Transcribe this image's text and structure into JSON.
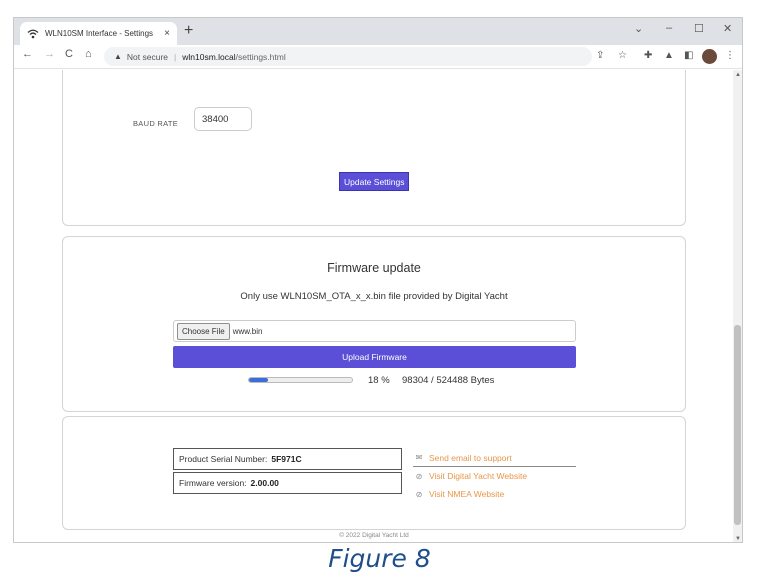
{
  "browser": {
    "tab_title": "WLN10SM Interface - Settings",
    "tab_close": "×",
    "new_tab": "+",
    "window_controls": {
      "minimize": "–",
      "maximize": "☐",
      "close": "✕",
      "menu": "⌄"
    },
    "nav": {
      "back": "←",
      "forward": "→",
      "reload": "C",
      "home": "⌂"
    },
    "security_label": "Not secure",
    "url_host": "wln10sm.local",
    "url_path": "/settings.html"
  },
  "settings": {
    "baud_label": "BAUD RATE",
    "baud_value": "38400",
    "update_button": "Update Settings"
  },
  "firmware": {
    "title": "Firmware update",
    "note": "Only use WLN10SM_OTA_x_x.bin file provided by Digital Yacht",
    "choose_file": "Choose File",
    "file_name": "www.bin",
    "upload_button": "Upload Firmware",
    "progress_fraction": 0.18,
    "progress_percent": "18 %",
    "progress_bytes": "98304 / 524488 Bytes"
  },
  "info": {
    "serial_label": "Product Serial Number:",
    "serial_value": "5F971C",
    "fw_label": "Firmware version:",
    "fw_value": "2.00.00",
    "links": [
      {
        "label": "Send email to support",
        "icon": "mail-icon"
      },
      {
        "label": "Visit Digital Yacht Website",
        "icon": "link-icon"
      },
      {
        "label": "Visit NMEA Website",
        "icon": "link-icon"
      }
    ]
  },
  "footer": "© 2022 Digital Yacht Ltd",
  "caption": "Figure 8",
  "colors": {
    "accent": "#5a4fd6",
    "link": "#e8964a",
    "caption": "#1f4e8c"
  }
}
